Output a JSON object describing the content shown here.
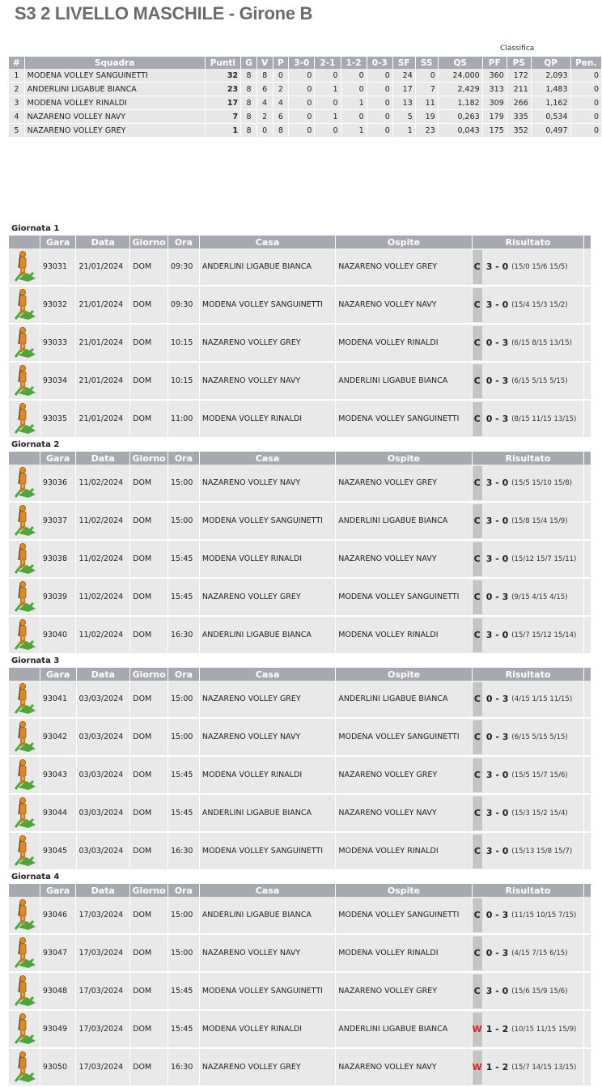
{
  "page": {
    "title": "S3 2 LIVELLO MASCHILE - Girone B"
  },
  "standings": {
    "caption": "Classifica",
    "headers": [
      "#",
      "Squadra",
      "Punti",
      "G",
      "V",
      "P",
      "3-0",
      "2-1",
      "1-2",
      "0-3",
      "SF",
      "SS",
      "QS",
      "PF",
      "PS",
      "QP",
      "Pen."
    ],
    "rows": [
      [
        "1",
        "MODENA VOLLEY SANGUINETTI",
        "32",
        "8",
        "8",
        "0",
        "0",
        "0",
        "0",
        "0",
        "24",
        "0",
        "24,000",
        "360",
        "172",
        "2,093",
        "0"
      ],
      [
        "2",
        "ANDERLINI LIGABUE BIANCA",
        "23",
        "8",
        "6",
        "2",
        "0",
        "1",
        "0",
        "0",
        "17",
        "7",
        "2,429",
        "313",
        "211",
        "1,483",
        "0"
      ],
      [
        "3",
        "MODENA VOLLEY RINALDI",
        "17",
        "8",
        "4",
        "4",
        "0",
        "0",
        "1",
        "0",
        "13",
        "11",
        "1,182",
        "309",
        "266",
        "1,162",
        "0"
      ],
      [
        "4",
        "NAZARENO VOLLEY NAVY",
        "7",
        "8",
        "2",
        "6",
        "0",
        "1",
        "0",
        "0",
        "5",
        "19",
        "0,263",
        "179",
        "335",
        "0,534",
        "0"
      ],
      [
        "5",
        "NAZARENO VOLLEY GREY",
        "1",
        "8",
        "0",
        "8",
        "0",
        "0",
        "1",
        "0",
        "1",
        "23",
        "0,043",
        "175",
        "352",
        "0,497",
        "0"
      ]
    ]
  },
  "fixture_headers": [
    "",
    "Gara",
    "Data",
    "Giorno",
    "Ora",
    "Casa",
    "Ospite",
    "Risultato"
  ],
  "rounds": [
    {
      "label": "Giornata 1",
      "matches": [
        {
          "gara": "93031",
          "data": "21/01/2024",
          "giorno": "DOM",
          "ora": "09:30",
          "casa": "ANDERLINI LIGABUE BIANCA",
          "ospite": "NAZARENO VOLLEY GREY",
          "flag": "C",
          "score": "3 - 0",
          "sets": "(15/0 15/6 15/5)"
        },
        {
          "gara": "93032",
          "data": "21/01/2024",
          "giorno": "DOM",
          "ora": "09:30",
          "casa": "MODENA VOLLEY SANGUINETTI",
          "ospite": "NAZARENO VOLLEY NAVY",
          "flag": "C",
          "score": "3 - 0",
          "sets": "(15/4 15/3 15/2)"
        },
        {
          "gara": "93033",
          "data": "21/01/2024",
          "giorno": "DOM",
          "ora": "10:15",
          "casa": "NAZARENO VOLLEY GREY",
          "ospite": "MODENA VOLLEY RINALDI",
          "flag": "C",
          "score": "0 - 3",
          "sets": "(6/15 8/15 13/15)"
        },
        {
          "gara": "93034",
          "data": "21/01/2024",
          "giorno": "DOM",
          "ora": "10:15",
          "casa": "NAZARENO VOLLEY NAVY",
          "ospite": "ANDERLINI LIGABUE BIANCA",
          "flag": "C",
          "score": "0 - 3",
          "sets": "(6/15 5/15 5/15)"
        },
        {
          "gara": "93035",
          "data": "21/01/2024",
          "giorno": "DOM",
          "ora": "11:00",
          "casa": "MODENA VOLLEY RINALDI",
          "ospite": "MODENA VOLLEY SANGUINETTI",
          "flag": "C",
          "score": "0 - 3",
          "sets": "(8/15 11/15 13/15)"
        }
      ]
    },
    {
      "label": "Giornata 2",
      "matches": [
        {
          "gara": "93036",
          "data": "11/02/2024",
          "giorno": "DOM",
          "ora": "15:00",
          "casa": "NAZARENO VOLLEY NAVY",
          "ospite": "NAZARENO VOLLEY GREY",
          "flag": "C",
          "score": "3 - 0",
          "sets": "(15/5 15/10 15/8)"
        },
        {
          "gara": "93037",
          "data": "11/02/2024",
          "giorno": "DOM",
          "ora": "15:00",
          "casa": "MODENA VOLLEY SANGUINETTI",
          "ospite": "ANDERLINI LIGABUE BIANCA",
          "flag": "C",
          "score": "3 - 0",
          "sets": "(15/8 15/4 15/9)"
        },
        {
          "gara": "93038",
          "data": "11/02/2024",
          "giorno": "DOM",
          "ora": "15:45",
          "casa": "MODENA VOLLEY RINALDI",
          "ospite": "NAZARENO VOLLEY NAVY",
          "flag": "C",
          "score": "3 - 0",
          "sets": "(15/12 15/7 15/11)"
        },
        {
          "gara": "93039",
          "data": "11/02/2024",
          "giorno": "DOM",
          "ora": "15:45",
          "casa": "NAZARENO VOLLEY GREY",
          "ospite": "MODENA VOLLEY SANGUINETTI",
          "flag": "C",
          "score": "0 - 3",
          "sets": "(9/15 4/15 4/15)"
        },
        {
          "gara": "93040",
          "data": "11/02/2024",
          "giorno": "DOM",
          "ora": "16:30",
          "casa": "ANDERLINI LIGABUE BIANCA",
          "ospite": "MODENA VOLLEY RINALDI",
          "flag": "C",
          "score": "3 - 0",
          "sets": "(15/7 15/12 15/14)"
        }
      ]
    },
    {
      "label": "Giornata 3",
      "matches": [
        {
          "gara": "93041",
          "data": "03/03/2024",
          "giorno": "DOM",
          "ora": "15:00",
          "casa": "NAZARENO VOLLEY GREY",
          "ospite": "ANDERLINI LIGABUE BIANCA",
          "flag": "C",
          "score": "0 - 3",
          "sets": "(4/15 1/15 11/15)"
        },
        {
          "gara": "93042",
          "data": "03/03/2024",
          "giorno": "DOM",
          "ora": "15:00",
          "casa": "NAZARENO VOLLEY NAVY",
          "ospite": "MODENA VOLLEY SANGUINETTI",
          "flag": "C",
          "score": "0 - 3",
          "sets": "(6/15 5/15 5/15)"
        },
        {
          "gara": "93043",
          "data": "03/03/2024",
          "giorno": "DOM",
          "ora": "15:45",
          "casa": "MODENA VOLLEY RINALDI",
          "ospite": "NAZARENO VOLLEY GREY",
          "flag": "C",
          "score": "3 - 0",
          "sets": "(15/5 15/7 15/6)"
        },
        {
          "gara": "93044",
          "data": "03/03/2024",
          "giorno": "DOM",
          "ora": "15:45",
          "casa": "ANDERLINI LIGABUE BIANCA",
          "ospite": "NAZARENO VOLLEY NAVY",
          "flag": "C",
          "score": "3 - 0",
          "sets": "(15/3 15/2 15/4)"
        },
        {
          "gara": "93045",
          "data": "03/03/2024",
          "giorno": "DOM",
          "ora": "16:30",
          "casa": "MODENA VOLLEY SANGUINETTI",
          "ospite": "MODENA VOLLEY RINALDI",
          "flag": "C",
          "score": "3 - 0",
          "sets": "(15/13 15/8 15/7)"
        }
      ]
    },
    {
      "label": "Giornata 4",
      "matches": [
        {
          "gara": "93046",
          "data": "17/03/2024",
          "giorno": "DOM",
          "ora": "15:00",
          "casa": "ANDERLINI LIGABUE BIANCA",
          "ospite": "MODENA VOLLEY SANGUINETTI",
          "flag": "C",
          "score": "0 - 3",
          "sets": "(11/15 10/15 7/15)"
        },
        {
          "gara": "93047",
          "data": "17/03/2024",
          "giorno": "DOM",
          "ora": "15:00",
          "casa": "NAZARENO VOLLEY NAVY",
          "ospite": "MODENA VOLLEY RINALDI",
          "flag": "C",
          "score": "0 - 3",
          "sets": "(4/15 7/15 6/15)"
        },
        {
          "gara": "93048",
          "data": "17/03/2024",
          "giorno": "DOM",
          "ora": "15:45",
          "casa": "MODENA VOLLEY SANGUINETTI",
          "ospite": "NAZARENO VOLLEY GREY",
          "flag": "C",
          "score": "3 - 0",
          "sets": "(15/6 15/9 15/6)"
        },
        {
          "gara": "93049",
          "data": "17/03/2024",
          "giorno": "DOM",
          "ora": "15:45",
          "casa": "MODENA VOLLEY RINALDI",
          "ospite": "ANDERLINI LIGABUE BIANCA",
          "flag": "W",
          "score": "1 - 2",
          "sets": "(10/15 11/15 15/9)"
        },
        {
          "gara": "93050",
          "data": "17/03/2024",
          "giorno": "DOM",
          "ora": "16:30",
          "casa": "NAZARENO VOLLEY GREY",
          "ospite": "NAZARENO VOLLEY NAVY",
          "flag": "W",
          "score": "1 - 2",
          "sets": "(15/7 14/15 13/15)"
        }
      ]
    }
  ],
  "icons": {
    "row_icon": "referee-figure-icon"
  },
  "colors": {
    "header_bg": "#a6aab0",
    "row_bg": "#e9e9e9",
    "flag_bg": "#c4c4c4",
    "warning_flag": "#e02020",
    "icon_orange": "#e08a1e",
    "icon_green": "#4aa83a"
  }
}
